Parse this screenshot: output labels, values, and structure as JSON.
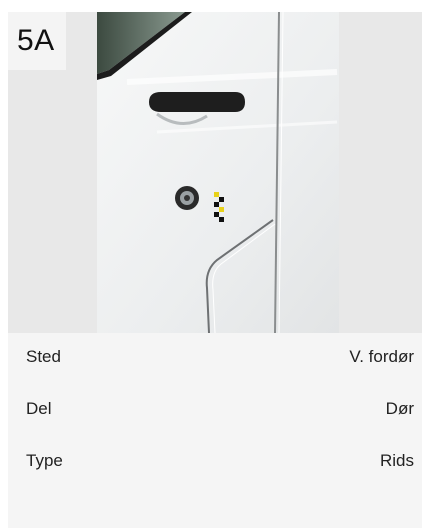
{
  "badge": {
    "label": "5A"
  },
  "details": [
    {
      "label": "Sted",
      "value": "V. fordør"
    },
    {
      "label": "Del",
      "value": "Dør"
    },
    {
      "label": "Type",
      "value": "Rids"
    }
  ]
}
